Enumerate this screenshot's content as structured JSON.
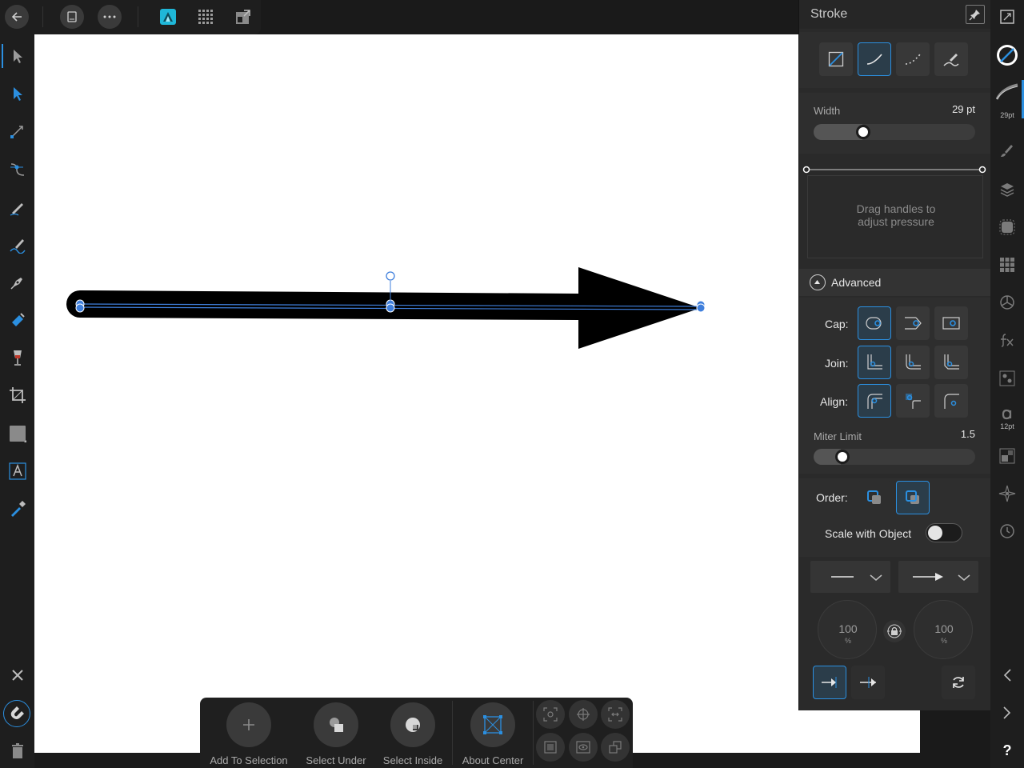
{
  "app": {
    "accent": "#2b8fe0"
  },
  "topbar": {
    "icons": [
      "back-arrow-icon",
      "document-icon",
      "more-icon",
      "designer-persona-icon",
      "pixel-persona-icon",
      "export-persona-icon"
    ]
  },
  "panel": {
    "title": "Stroke",
    "width": {
      "label": "Width",
      "value": "29 pt",
      "fraction": 0.3
    },
    "pressure": {
      "hint_line1": "Drag handles to",
      "hint_line2": "adjust pressure"
    },
    "advanced": {
      "label": "Advanced"
    },
    "cap": {
      "label": "Cap:"
    },
    "join": {
      "label": "Join:"
    },
    "align": {
      "label": "Align:"
    },
    "miter": {
      "label": "Miter Limit",
      "value": "1.5",
      "fraction": 0.17
    },
    "order": {
      "label": "Order:"
    },
    "scale": {
      "label": "Scale with Object",
      "on": false
    },
    "start_scale": {
      "value": "100",
      "unit": "%"
    },
    "end_scale": {
      "value": "100",
      "unit": "%"
    }
  },
  "rightbar": {
    "brush_size_label": "29pt",
    "text_size_label": "12pt",
    "help_label": "?"
  },
  "ctxbar": {
    "add_to_selection": "Add To Selection",
    "select_under": "Select Under",
    "select_inside": "Select Inside",
    "about_center": "About Center"
  }
}
